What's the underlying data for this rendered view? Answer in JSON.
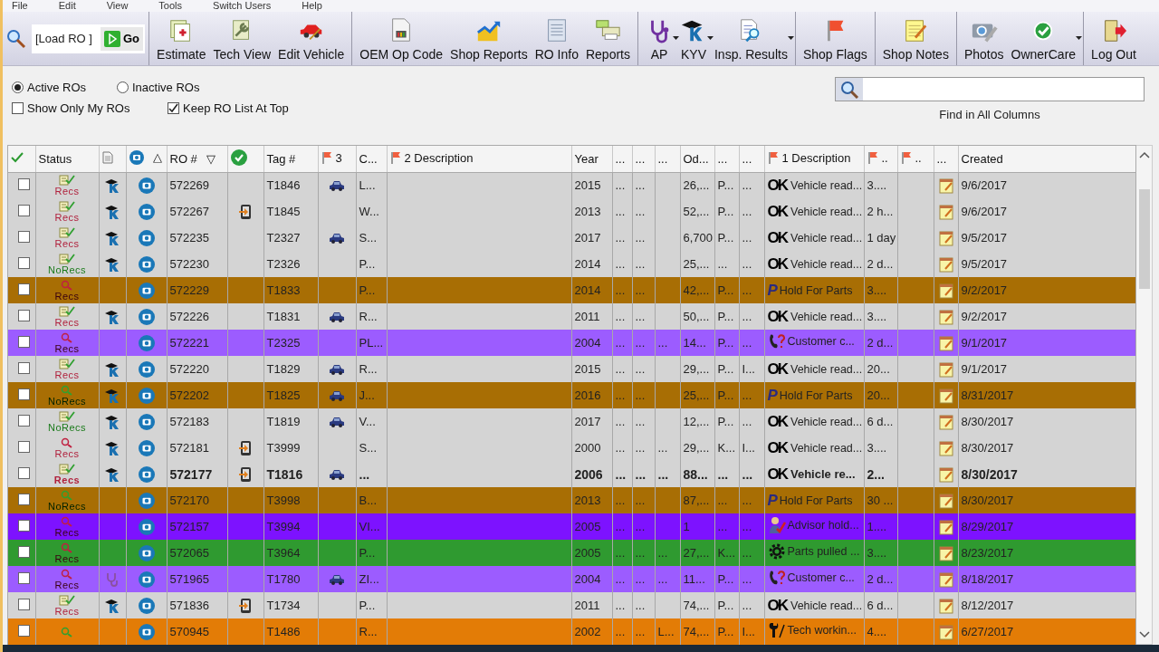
{
  "menu": [
    "File",
    "Edit",
    "View",
    "Tools",
    "Switch Users",
    "Help"
  ],
  "toolbar": {
    "load_field": {
      "value": "[Load RO ]"
    },
    "go": "Go",
    "buttons": [
      {
        "label": "Estimate",
        "dropdown": false,
        "group_start": true
      },
      {
        "label": "Tech View",
        "dropdown": false,
        "group_start": false
      },
      {
        "label": "Edit Vehicle",
        "dropdown": false,
        "group_start": false
      },
      {
        "label": "OEM Op Code",
        "dropdown": false,
        "group_start": true
      },
      {
        "label": "Shop Reports",
        "dropdown": false,
        "group_start": false
      },
      {
        "label": "RO Info",
        "dropdown": false,
        "group_start": false
      },
      {
        "label": "Reports",
        "dropdown": false,
        "group_start": false
      },
      {
        "label": "AP",
        "dropdown": true,
        "group_start": true
      },
      {
        "label": "KYV",
        "dropdown": true,
        "group_start": false
      },
      {
        "label": "Insp. Results",
        "dropdown": true,
        "group_start": false
      },
      {
        "label": "Shop Flags",
        "dropdown": false,
        "group_start": true
      },
      {
        "label": "Shop Notes",
        "dropdown": false,
        "group_start": true
      },
      {
        "label": "Photos",
        "dropdown": false,
        "group_start": true
      },
      {
        "label": "OwnerCare",
        "dropdown": true,
        "group_start": false
      },
      {
        "label": "Log Out",
        "dropdown": false,
        "group_start": true
      }
    ]
  },
  "filters": {
    "radios": [
      {
        "label": "Active ROs",
        "selected": true
      },
      {
        "label": "Inactive ROs",
        "selected": false
      }
    ],
    "checkboxes": [
      {
        "label": "Show Only My ROs",
        "checked": false
      },
      {
        "label": "Keep RO List At Top",
        "checked": true
      }
    ]
  },
  "search": {
    "caption": "Find in All Columns"
  },
  "table": {
    "columns": [
      {
        "kind": "check"
      },
      {
        "label": "Status"
      },
      {
        "kind": "doc"
      },
      {
        "kind": "camera",
        "sort": "△"
      },
      {
        "label": "RO #",
        "sort": "▽"
      },
      {
        "kind": "ok"
      },
      {
        "label": "Tag #"
      },
      {
        "kind": "flag",
        "label": "3"
      },
      {
        "label": "C..."
      },
      {
        "kind": "flag",
        "label": "2 Description"
      },
      {
        "label": "Year"
      },
      {
        "label": "..."
      },
      {
        "label": "..."
      },
      {
        "label": "..."
      },
      {
        "label": "Od..."
      },
      {
        "label": "..."
      },
      {
        "label": "..."
      },
      {
        "kind": "flag",
        "label": "1 Description"
      },
      {
        "kind": "flag",
        "label": ".."
      },
      {
        "kind": "flag",
        "label": ".."
      },
      {
        "label": "..."
      },
      {
        "label": "Created"
      }
    ],
    "rows": [
      {
        "checked": false,
        "status": {
          "kind": "sheet",
          "text": "Recs",
          "recs": true
        },
        "tech": {
          "kind": "kyv"
        },
        "ro": "572269",
        "phone": false,
        "tag": "T1846",
        "car": true,
        "c": "L...",
        "year": "2015",
        "a": "...",
        "b": "...",
        "odo": "26,...",
        "e": "P...",
        "f": "...",
        "desc": {
          "kind": "ok",
          "badge": "OK",
          "text": "Vehicle read..."
        },
        "g": "3....",
        "created": "9/6/2017",
        "bold": false,
        "color": "#d4d4d4"
      },
      {
        "checked": false,
        "status": {
          "kind": "sheet",
          "text": "Recs",
          "recs": true
        },
        "tech": {
          "kind": "kyv"
        },
        "ro": "572267",
        "phone": true,
        "tag": "T1845",
        "car": false,
        "c": "W...",
        "year": "2013",
        "a": "...",
        "b": "...",
        "odo": "52,...",
        "e": "P...",
        "f": "...",
        "desc": {
          "kind": "ok",
          "badge": "OK",
          "text": "Vehicle read..."
        },
        "g": "2 h...",
        "created": "9/6/2017",
        "bold": false,
        "color": "#d4d4d4"
      },
      {
        "checked": false,
        "status": {
          "kind": "sheet",
          "text": "Recs",
          "recs": true
        },
        "tech": {
          "kind": "kyv"
        },
        "ro": "572235",
        "phone": false,
        "tag": "T2327",
        "car": true,
        "c": "S...",
        "year": "2017",
        "a": "...",
        "b": "...",
        "odo": "6,700",
        "e": "P...",
        "f": "...",
        "desc": {
          "kind": "ok",
          "badge": "OK",
          "text": "Vehicle read..."
        },
        "g": "1 day",
        "created": "9/5/2017",
        "bold": false,
        "color": "#d4d4d4"
      },
      {
        "checked": false,
        "status": {
          "kind": "sheet",
          "text": "NoRecs",
          "recs": false
        },
        "tech": {
          "kind": "kyv"
        },
        "ro": "572230",
        "phone": false,
        "tag": "T2326",
        "car": false,
        "c": "P...",
        "year": "2014",
        "a": "...",
        "b": "...",
        "odo": "25,...",
        "e": "...",
        "f": "...",
        "desc": {
          "kind": "ok",
          "badge": "OK",
          "text": "Vehicle read..."
        },
        "g": "2 d...",
        "created": "9/5/2017",
        "bold": false,
        "color": "#d4d4d4"
      },
      {
        "checked": false,
        "status": {
          "kind": "magnifier",
          "text": "Recs",
          "recs": true
        },
        "tech": {
          "kind": "none"
        },
        "ro": "572229",
        "phone": false,
        "tag": "T1833",
        "car": false,
        "c": "P...",
        "year": "2014",
        "a": "...",
        "b": "...",
        "odo": "42,...",
        "e": "P...",
        "f": "...",
        "desc": {
          "kind": "p",
          "badge": "P",
          "text": "Hold For Parts"
        },
        "g": "3....",
        "created": "9/2/2017",
        "bold": false,
        "color": "#a86e04"
      },
      {
        "checked": false,
        "status": {
          "kind": "sheet",
          "text": "Recs",
          "recs": true
        },
        "tech": {
          "kind": "kyv"
        },
        "ro": "572226",
        "phone": false,
        "tag": "T1831",
        "car": true,
        "c": "R...",
        "year": "2011",
        "a": "...",
        "b": "...",
        "odo": "50,...",
        "e": "P...",
        "f": "...",
        "desc": {
          "kind": "ok",
          "badge": "OK",
          "text": "Vehicle read..."
        },
        "g": "3....",
        "created": "9/2/2017",
        "bold": false,
        "color": "#d4d4d4"
      },
      {
        "checked": false,
        "status": {
          "kind": "magnifier",
          "text": "Recs",
          "recs": true
        },
        "tech": {
          "kind": "none"
        },
        "ro": "572221",
        "phone": false,
        "tag": "T2325",
        "car": false,
        "c": "PL...",
        "year": "2004",
        "a": "...",
        "b": "...",
        "d": "...",
        "odo": "14...",
        "e": "P...",
        "f": "...",
        "desc": {
          "kind": "call",
          "text": "Customer c..."
        },
        "g": "2 d...",
        "created": "9/1/2017",
        "bold": false,
        "color": "#9c5cff"
      },
      {
        "checked": false,
        "status": {
          "kind": "sheet",
          "text": "Recs",
          "recs": true
        },
        "tech": {
          "kind": "kyv"
        },
        "ro": "572220",
        "phone": false,
        "tag": "T1829",
        "car": true,
        "c": "R...",
        "year": "2015",
        "a": "...",
        "b": "...",
        "odo": "29,...",
        "e": "P...",
        "f": "I...",
        "desc": {
          "kind": "ok",
          "badge": "OK",
          "text": "Vehicle read..."
        },
        "g": "20...",
        "created": "9/1/2017",
        "bold": false,
        "color": "#d4d4d4"
      },
      {
        "checked": false,
        "status": {
          "kind": "magnifier",
          "text": "NoRecs",
          "recs": false
        },
        "tech": {
          "kind": "kyv"
        },
        "ro": "572202",
        "phone": false,
        "tag": "T1825",
        "car": true,
        "c": "J...",
        "year": "2016",
        "a": "...",
        "b": "...",
        "odo": "25,...",
        "e": "P...",
        "f": "...",
        "desc": {
          "kind": "p",
          "badge": "P",
          "text": "Hold For Parts"
        },
        "g": "20...",
        "created": "8/31/2017",
        "bold": false,
        "color": "#a86e04"
      },
      {
        "checked": false,
        "status": {
          "kind": "sheet",
          "text": "NoRecs",
          "recs": false
        },
        "tech": {
          "kind": "kyv"
        },
        "ro": "572183",
        "phone": false,
        "tag": "T1819",
        "car": true,
        "c": "V...",
        "year": "2017",
        "a": "...",
        "b": "...",
        "odo": "12,...",
        "e": "P...",
        "f": "...",
        "desc": {
          "kind": "ok",
          "badge": "OK",
          "text": "Vehicle read..."
        },
        "g": "6 d...",
        "created": "8/30/2017",
        "bold": false,
        "color": "#d4d4d4"
      },
      {
        "checked": false,
        "status": {
          "kind": "magnifier",
          "text": "Recs",
          "recs": true
        },
        "tech": {
          "kind": "kyv"
        },
        "ro": "572181",
        "phone": true,
        "tag": "T3999",
        "car": false,
        "c": "S...",
        "year": "2000",
        "a": "...",
        "b": "...",
        "d": "...",
        "odo": "29,...",
        "e": "K...",
        "f": "I...",
        "desc": {
          "kind": "ok",
          "badge": "OK",
          "text": "Vehicle read..."
        },
        "g": "3....",
        "created": "8/30/2017",
        "bold": false,
        "color": "#d4d4d4"
      },
      {
        "checked": false,
        "status": {
          "kind": "sheet",
          "text": "Recs",
          "recs": true
        },
        "tech": {
          "kind": "kyv"
        },
        "ro": "572177",
        "phone": true,
        "tag": "T1816",
        "car": true,
        "c": "...",
        "year": "2006",
        "a": "...",
        "b": "...",
        "d": "...",
        "odo": "88...",
        "e": "...",
        "f": "...",
        "desc": {
          "kind": "ok",
          "badge": "OK",
          "text": "Vehicle re..."
        },
        "g": "2...",
        "created": "8/30/2017",
        "bold": true,
        "color": "#d4d4d4"
      },
      {
        "checked": false,
        "status": {
          "kind": "magnifier",
          "text": "NoRecs",
          "recs": false
        },
        "tech": {
          "kind": "none"
        },
        "ro": "572170",
        "phone": false,
        "tag": "T3998",
        "car": false,
        "c": "B...",
        "year": "2013",
        "a": "...",
        "b": "...",
        "odo": "87,...",
        "e": "...",
        "f": "...",
        "desc": {
          "kind": "p",
          "badge": "P",
          "text": "Hold For Parts"
        },
        "g": "30 ...",
        "created": "8/30/2017",
        "bold": false,
        "color": "#a86e04"
      },
      {
        "checked": false,
        "status": {
          "kind": "magnifier",
          "text": "Recs",
          "recs": true
        },
        "tech": {
          "kind": "none"
        },
        "ro": "572157",
        "phone": false,
        "tag": "T3994",
        "car": false,
        "c": "VI...",
        "year": "2005",
        "a": "...",
        "b": "...",
        "odo": "1",
        "e": "...",
        "f": "...",
        "desc": {
          "kind": "advisor",
          "text": "Advisor hold..."
        },
        "g": "1....",
        "created": "8/29/2017",
        "bold": false,
        "color": "#7d12ff"
      },
      {
        "checked": false,
        "status": {
          "kind": "magnifier",
          "text": "Recs",
          "recs": true
        },
        "tech": {
          "kind": "none"
        },
        "ro": "572065",
        "phone": false,
        "tag": "T3964",
        "car": false,
        "c": "P...",
        "year": "2005",
        "a": "...",
        "b": "...",
        "d": "...",
        "odo": "27,...",
        "e": "K...",
        "f": "...",
        "desc": {
          "kind": "gear",
          "text": "Parts pulled ..."
        },
        "g": "3....",
        "created": "8/23/2017",
        "bold": false,
        "color": "#2f9a30"
      },
      {
        "checked": false,
        "status": {
          "kind": "magnifier",
          "text": "Recs",
          "recs": true
        },
        "tech": {
          "kind": "ap"
        },
        "ro": "571965",
        "phone": false,
        "tag": "T1780",
        "car": true,
        "c": "ZI...",
        "year": "2004",
        "a": "...",
        "b": "...",
        "d": "...",
        "odo": "11...",
        "e": "P...",
        "f": "...",
        "desc": {
          "kind": "call",
          "text": "Customer c..."
        },
        "g": "2 d...",
        "created": "8/18/2017",
        "bold": false,
        "color": "#9c5cff"
      },
      {
        "checked": false,
        "status": {
          "kind": "sheet",
          "text": "Recs",
          "recs": true
        },
        "tech": {
          "kind": "kyv"
        },
        "ro": "571836",
        "phone": true,
        "tag": "T1734",
        "car": false,
        "c": "P...",
        "year": "2011",
        "a": "...",
        "b": "...",
        "odo": "74,...",
        "e": "P...",
        "f": "...",
        "desc": {
          "kind": "ok",
          "badge": "OK",
          "text": "Vehicle read..."
        },
        "g": "6 d...",
        "created": "8/12/2017",
        "bold": false,
        "color": "#d4d4d4"
      },
      {
        "checked": false,
        "status": {
          "kind": "magnifier",
          "recs": false
        },
        "tech": {
          "kind": "none"
        },
        "ro": "570945",
        "phone": false,
        "tag": "T1486",
        "car": false,
        "c": "R...",
        "year": "2002",
        "a": "...",
        "b": "...",
        "d": "L...",
        "odo": "74,...",
        "e": "P...",
        "f": "I...",
        "desc": {
          "kind": "wrench",
          "text": "Tech workin..."
        },
        "g": "4....",
        "created": "6/27/2017",
        "bold": false,
        "color": "#e37c06"
      }
    ]
  }
}
